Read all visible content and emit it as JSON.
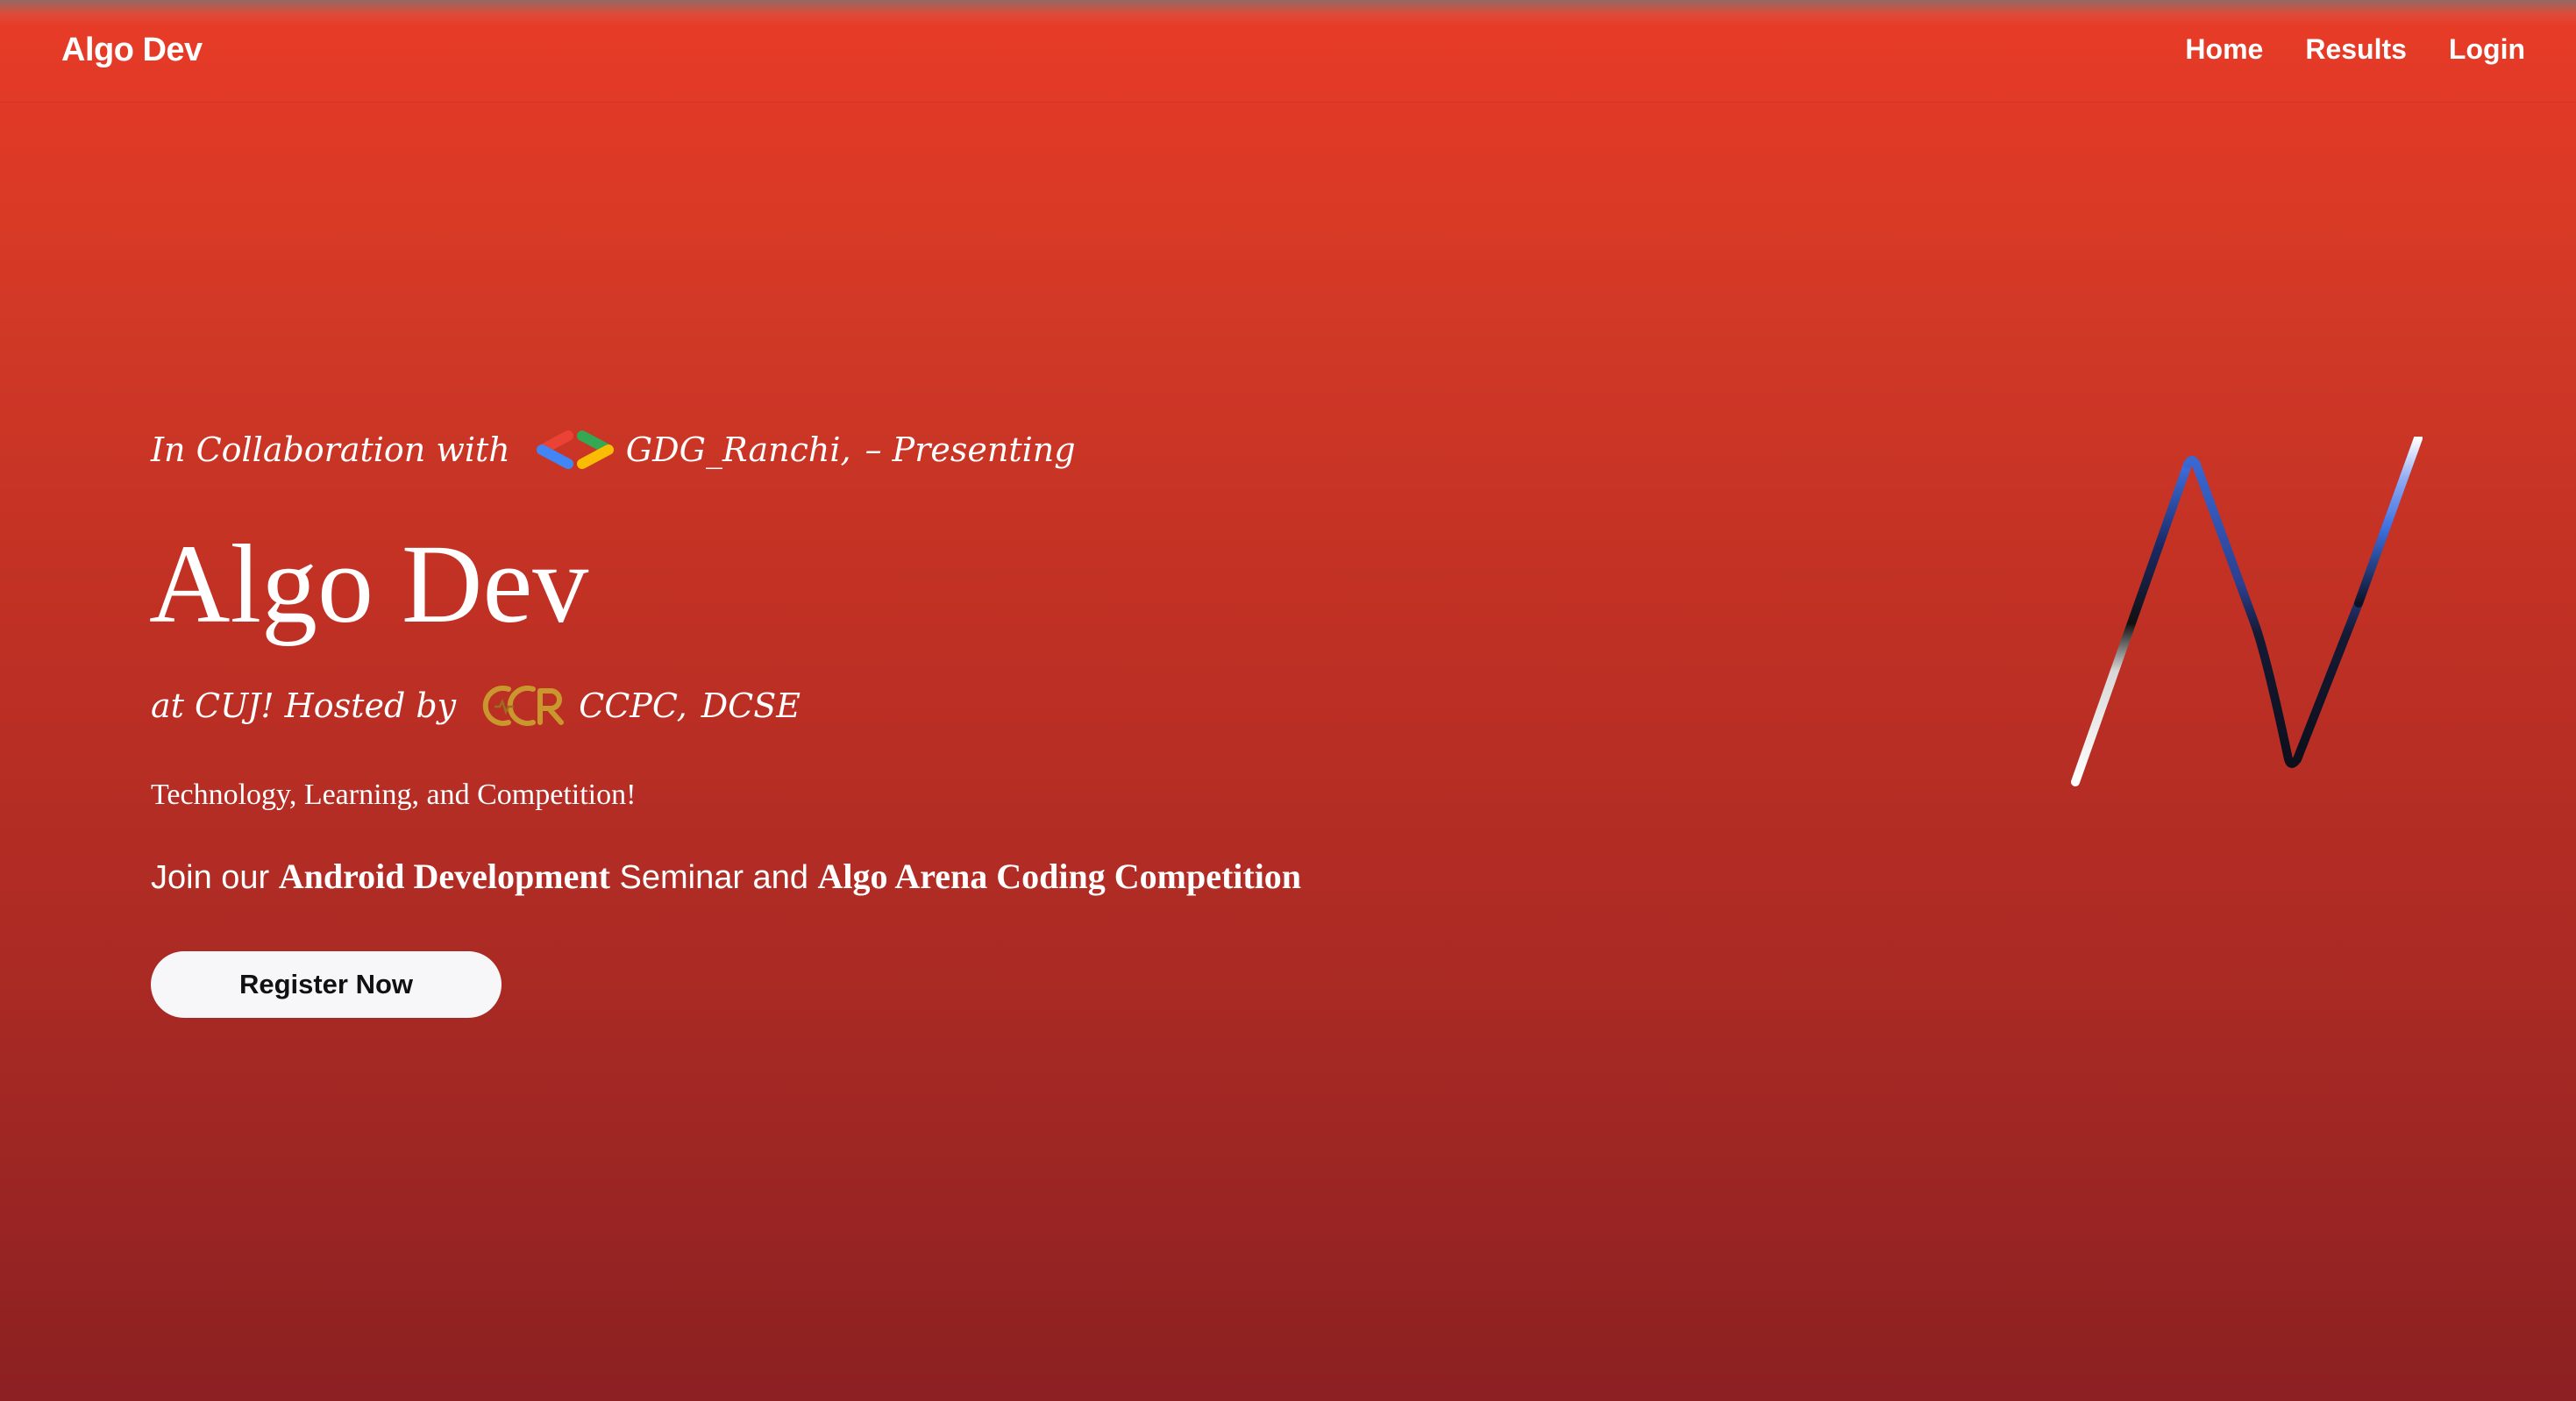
{
  "navbar": {
    "brand": "Algo Dev",
    "links": [
      {
        "label": "Home"
      },
      {
        "label": "Results"
      },
      {
        "label": "Login"
      }
    ]
  },
  "hero": {
    "collab_prefix": "In Collaboration with",
    "collab_partner": "GDG_Ranchi,",
    "collab_suffix": "– Presenting",
    "title": "Algo Dev",
    "hosted_prefix": "at CUJ! Hosted by",
    "hosted_org": "CCPC,",
    "hosted_dept": "DCSE",
    "tagline": "Technology, Learning, and Competition!",
    "join": {
      "part1": "Join our",
      "bold1": "Android Development",
      "part2": "Seminar and",
      "bold2": "Algo Arena Coding Competition"
    },
    "register_label": "Register Now"
  },
  "icons": {
    "gdg_logo": "gdg-logo-icon",
    "ccpc_logo": "ccpc-logo-icon",
    "algo_dev_logo": "algo-dev-logo-icon"
  },
  "colors": {
    "gradient_top": "#e83b27",
    "gradient_bottom": "#8c2022",
    "button_bg": "#f7f7f9",
    "logo_blue": "#3d6fe0"
  }
}
